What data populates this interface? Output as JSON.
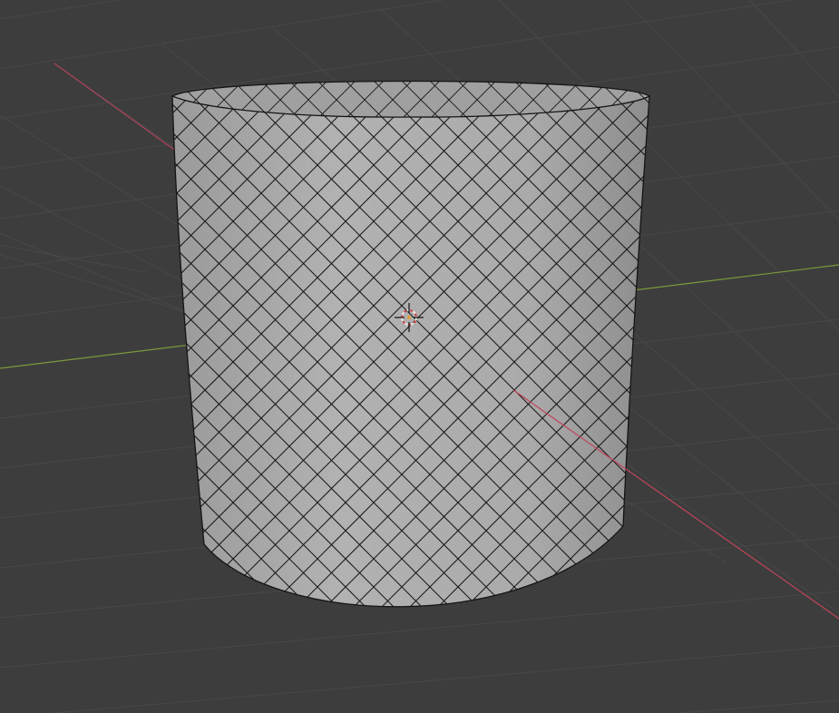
{
  "viewport": {
    "background_color": "#3d3d3d",
    "grid_color": "#484848",
    "x_axis_color": "#c0445a",
    "y_axis_color": "#7a9a3a",
    "mesh_face_color": "#a9a9a9",
    "mesh_edge_color": "#151515",
    "inner_face_color": "#9a9a9a"
  },
  "object": {
    "type": "cylinder",
    "wire_pattern": "diamond",
    "edge_directions": [
      "diagonal-up",
      "diagonal-down"
    ]
  },
  "cursor": {
    "icon": "3d-cursor-icon"
  }
}
